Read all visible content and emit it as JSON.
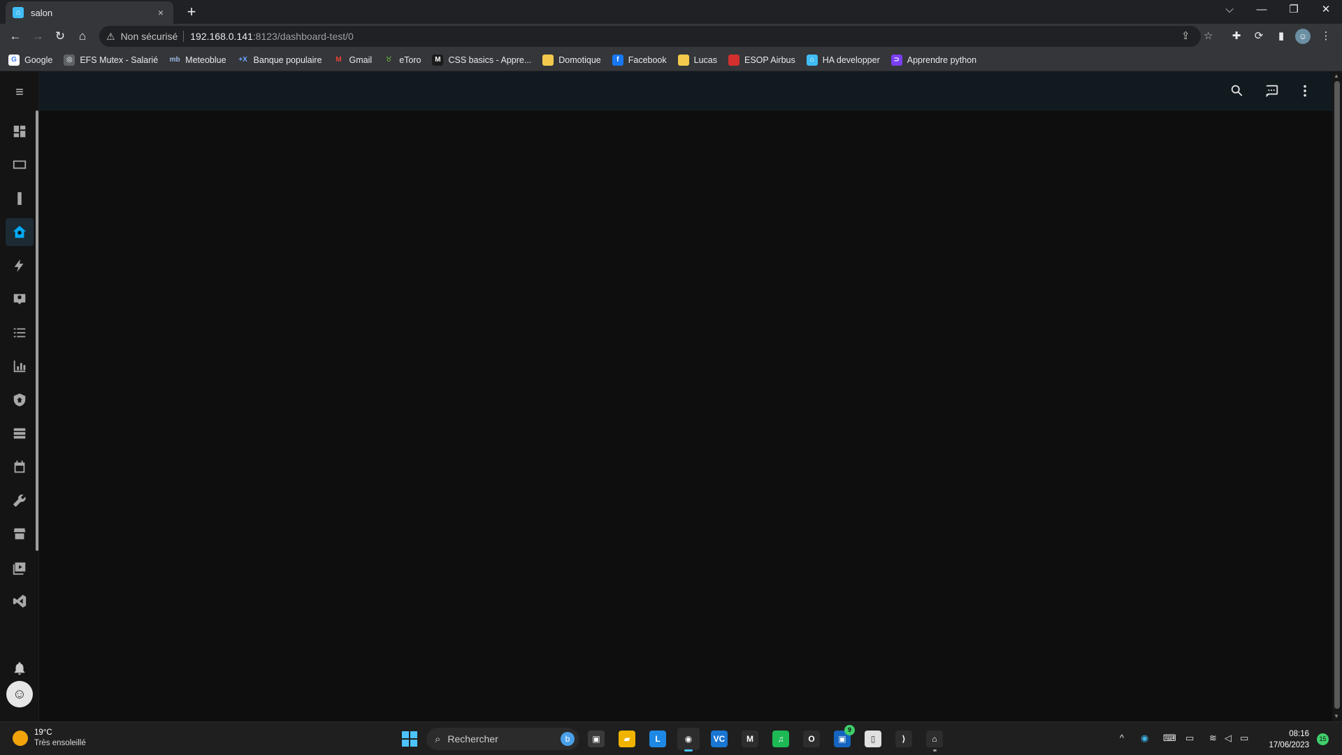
{
  "browser": {
    "tab": {
      "title": "salon",
      "close": "×"
    },
    "new_tab": "+",
    "window_controls": {
      "tabsearch": "⌵",
      "minimize": "—",
      "restore": "❐",
      "close": "✕"
    },
    "nav": {
      "back": "←",
      "forward": "→",
      "reload": "↻",
      "home": "⌂"
    },
    "address": {
      "security_icon": "⚠",
      "security_label": "Non sécurisé",
      "host": "192.168.0.141",
      "path": ":8123/dashboard-test/0"
    },
    "toolbar_icons": {
      "share": "⇪",
      "bookmark": "☆",
      "extensions": "✚",
      "sync": "⟳",
      "sidepanel": "▮",
      "profile": "☺",
      "menu": "⋮"
    },
    "bookmarks": [
      {
        "label": "Google",
        "icon": "G",
        "color": "#ffffff",
        "fg": "#4285f4"
      },
      {
        "label": "EFS Mutex - Salarié",
        "icon": "◎",
        "color": "#5f6368",
        "fg": "#ffffff"
      },
      {
        "label": "Meteoblue",
        "icon": "mb",
        "color": "#35363a",
        "fg": "#9bb9e6"
      },
      {
        "label": "Banque populaire",
        "icon": "+X",
        "color": "#35363a",
        "fg": "#6ea8ff"
      },
      {
        "label": "Gmail",
        "icon": "M",
        "color": "#35363a",
        "fg": "#ea4335"
      },
      {
        "label": "eToro",
        "icon": "♉",
        "color": "#35363a",
        "fg": "#6fcf3c"
      },
      {
        "label": "CSS basics - Appre...",
        "icon": "M",
        "color": "#1b1b1b",
        "fg": "#ffffff"
      },
      {
        "label": "Domotique",
        "icon": "▮",
        "color": "#f2c94c",
        "fg": "#f2c94c"
      },
      {
        "label": "Facebook",
        "icon": "f",
        "color": "#1877f2",
        "fg": "#ffffff"
      },
      {
        "label": "Lucas",
        "icon": "▮",
        "color": "#f2c94c",
        "fg": "#f2c94c"
      },
      {
        "label": "ESOP Airbus",
        "icon": "▬",
        "color": "#d32f2f",
        "fg": "#d32f2f"
      },
      {
        "label": "HA developper",
        "icon": "⌂",
        "color": "#41bdf5",
        "fg": "#ffffff"
      },
      {
        "label": "Apprendre python",
        "icon": "⊃",
        "color": "#7b3ff2",
        "fg": "#ffffff"
      }
    ]
  },
  "ha": {
    "menu_icon": "≡",
    "accent": "#03a9f4",
    "sidebar_items": [
      {
        "name": "sidebar-item-overview",
        "icon": "dashboard-icon"
      },
      {
        "name": "sidebar-item-dashboard-tv",
        "icon": "tv-icon"
      },
      {
        "name": "sidebar-item-dashboard-remote",
        "icon": "remote-icon"
      },
      {
        "name": "sidebar-item-dashboard-test",
        "icon": "home-assistant-icon",
        "active": true
      },
      {
        "name": "sidebar-item-energy",
        "icon": "lightning-icon"
      },
      {
        "name": "sidebar-item-map",
        "icon": "account-box-icon"
      },
      {
        "name": "sidebar-item-logbook",
        "icon": "list-icon"
      },
      {
        "name": "sidebar-item-history",
        "icon": "chart-bar-icon"
      },
      {
        "name": "sidebar-item-alarm",
        "icon": "shield-home-icon"
      },
      {
        "name": "sidebar-item-servers",
        "icon": "server-icon"
      },
      {
        "name": "sidebar-item-calendar",
        "icon": "calendar-icon"
      },
      {
        "name": "sidebar-item-developer-tools",
        "icon": "wrench-icon"
      },
      {
        "name": "sidebar-item-hacs",
        "icon": "hacs-icon"
      },
      {
        "name": "sidebar-item-media",
        "icon": "play-box-icon"
      },
      {
        "name": "sidebar-item-vscode",
        "icon": "vscode-icon"
      }
    ],
    "notifications_icon": "bell-icon",
    "avatar": "☺",
    "header_icons": [
      "search-icon",
      "assist-icon",
      "dots-vertical-icon"
    ]
  },
  "taskbar": {
    "weather": {
      "temp": "19°C",
      "condition": "Très ensoleillé"
    },
    "search_placeholder": "Rechercher",
    "search_icon": "⌕",
    "bing": "b",
    "apps": [
      {
        "name": "taskbar-task-view",
        "label": "▣",
        "bg": "#3a3a3a"
      },
      {
        "name": "taskbar-file-explorer",
        "label": "▰",
        "bg": "#f0b400"
      },
      {
        "name": "taskbar-app-l",
        "label": "L",
        "bg": "#1e88e5"
      },
      {
        "name": "taskbar-chrome",
        "label": "◉",
        "bg": "#2d2d2d",
        "active": true
      },
      {
        "name": "taskbar-app-vc",
        "label": "VC",
        "bg": "#1976d2"
      },
      {
        "name": "taskbar-gmail",
        "label": "M",
        "bg": "#2d2d2d"
      },
      {
        "name": "taskbar-spotify",
        "label": "♫",
        "bg": "#1db954"
      },
      {
        "name": "taskbar-opera",
        "label": "O",
        "bg": "#2d2d2d"
      },
      {
        "name": "taskbar-teams",
        "label": "▣",
        "bg": "#1565c0",
        "badge": "9"
      },
      {
        "name": "taskbar-notepad",
        "label": "▯",
        "bg": "#e0e0e0"
      },
      {
        "name": "taskbar-vscode",
        "label": "⟩",
        "bg": "#2d2d2d"
      },
      {
        "name": "taskbar-home-assistant",
        "label": "⌂",
        "bg": "#2d2d2d",
        "running": true
      }
    ],
    "tray": {
      "chevron": "^",
      "keyboard": "⌨",
      "display": "▭",
      "wifi": "≋",
      "volume": "◁",
      "battery": "▭"
    },
    "clock": {
      "time": "08:16",
      "date": "17/06/2023"
    },
    "notification_count": "15"
  }
}
